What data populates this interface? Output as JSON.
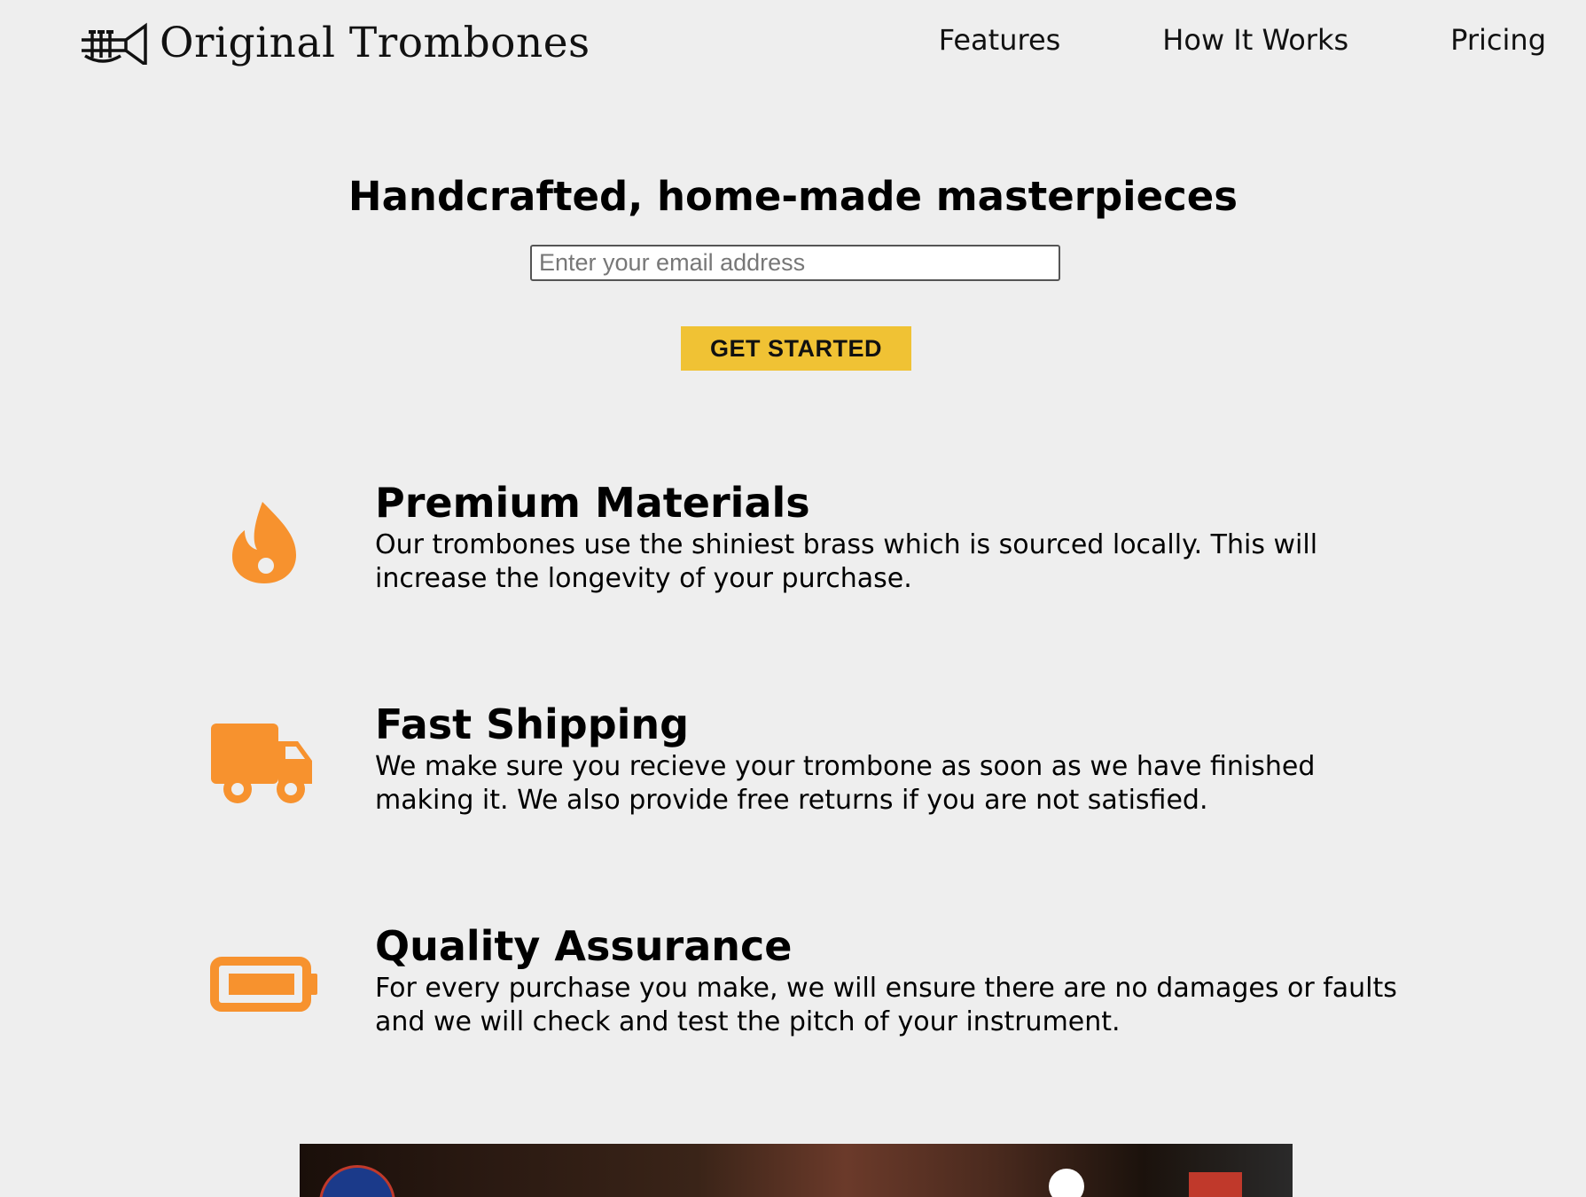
{
  "header": {
    "logo_text": "Original Trombones",
    "logo_icon": "trumpet-icon",
    "nav": [
      {
        "label": "Features"
      },
      {
        "label": "How It Works"
      },
      {
        "label": "Pricing"
      }
    ]
  },
  "hero": {
    "title": "Handcrafted, home-made masterpieces",
    "email_placeholder": "Enter your email address",
    "cta_label": "GET STARTED"
  },
  "features": [
    {
      "icon": "fire-icon",
      "title": "Premium Materials",
      "description": "Our trombones use the shiniest brass which is sourced locally. This will increase the longevity of your purchase."
    },
    {
      "icon": "truck-icon",
      "title": "Fast Shipping",
      "description": "We make sure you recieve your trombone as soon as we have finished making it. We also provide free returns if you are not satisfied."
    },
    {
      "icon": "battery-icon",
      "title": "Quality Assurance",
      "description": "For every purchase you make, we will ensure there are no damages or faults and we will check and test the pitch of your instrument."
    }
  ],
  "colors": {
    "background": "#eeeeee",
    "accent_orange": "#f7922e",
    "cta_yellow": "#f0c234"
  }
}
